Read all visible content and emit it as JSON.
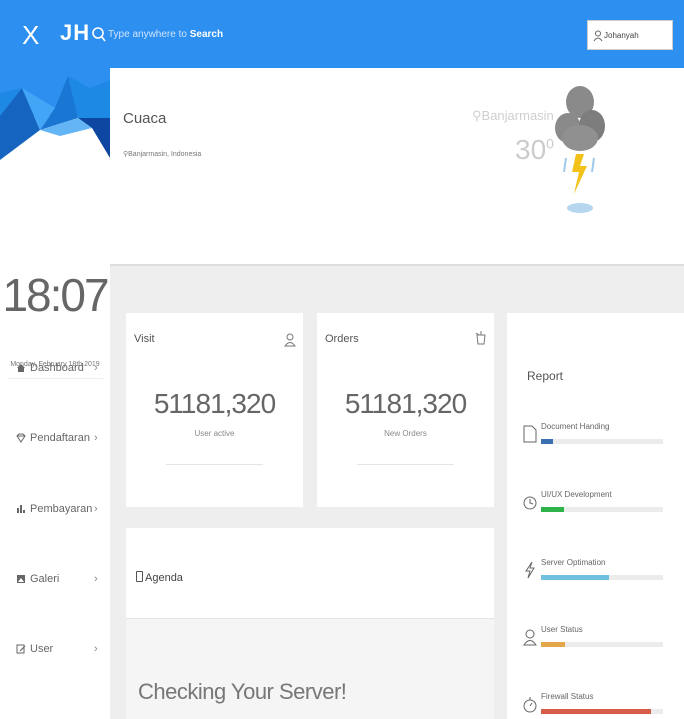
{
  "topbar": {
    "close_label": "X",
    "brand": "JH",
    "search_prefix": "Type anywhere to ",
    "search_keyword": "Search",
    "user_name": "Johanyah"
  },
  "sidebar": {
    "clock": "18:07",
    "date": "Monday, February 18th 2019",
    "items": [
      {
        "label": "Dashboard",
        "icon": "home-icon"
      },
      {
        "label": "Pendaftaran",
        "icon": "diamond-icon"
      },
      {
        "label": "Pembayaran",
        "icon": "bar-chart-icon"
      },
      {
        "label": "Galeri",
        "icon": "image-icon"
      },
      {
        "label": "User",
        "icon": "edit-icon"
      }
    ],
    "chevron": "›"
  },
  "weather": {
    "title": "Cuaca",
    "location": "Banjarmasin, Indonesia",
    "city": "Banjarmasin",
    "temp": "30",
    "temp_unit": "0",
    "icon": "thunderstorm-icon"
  },
  "cards": {
    "visit": {
      "title": "Visit",
      "value": "51181,320",
      "sub": "User active",
      "icon": "user-icon"
    },
    "orders": {
      "title": "Orders",
      "value": "51181,320",
      "sub": "New Orders",
      "icon": "cup-icon"
    }
  },
  "agenda": {
    "title": "Agenda",
    "heading": "Checking Your Server!"
  },
  "report": {
    "title": "Report",
    "items": [
      {
        "label": "Document Handing",
        "progress": 0.1,
        "color": "#3a6fb0",
        "icon": "document-icon"
      },
      {
        "label": "UI/UX Development",
        "progress": 0.19,
        "color": "#2eb24a",
        "icon": "clock-icon"
      },
      {
        "label": "Server Optimation",
        "progress": 0.56,
        "color": "#6fbfdf",
        "icon": "flash-icon"
      },
      {
        "label": "User Status",
        "progress": 0.2,
        "color": "#e2a84b",
        "icon": "user-icon"
      },
      {
        "label": "Firewall Status",
        "progress": 0.9,
        "color": "#d95c4a",
        "icon": "timer-icon"
      }
    ]
  }
}
